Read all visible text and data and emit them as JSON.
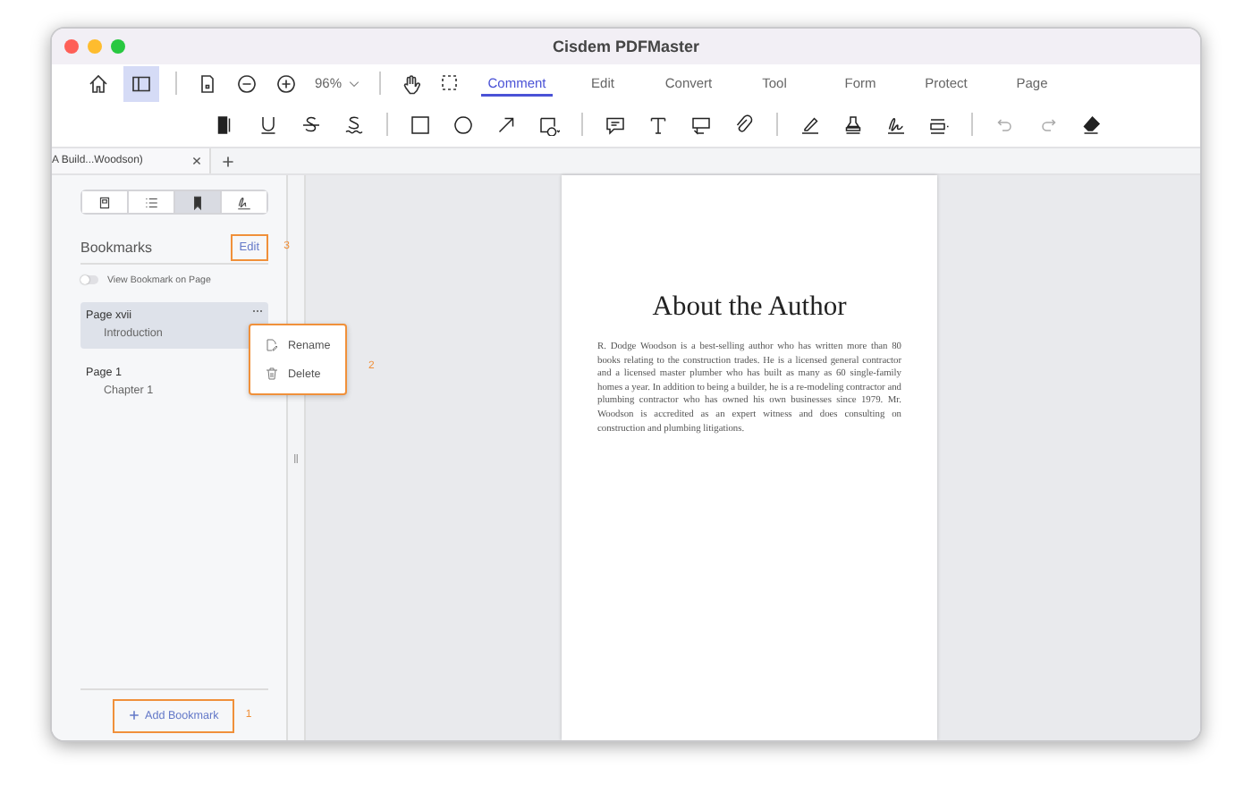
{
  "window": {
    "title": "Cisdem PDFMaster"
  },
  "toolbar": {
    "sidebar_toggle": {
      "selected": true
    },
    "zoom": "96%",
    "tabs": [
      {
        "label": "Comment",
        "selected": true
      },
      {
        "label": "Edit",
        "selected": false
      },
      {
        "label": "Convert",
        "selected": false
      },
      {
        "label": "Tool",
        "selected": false
      },
      {
        "label": "Form",
        "selected": false
      },
      {
        "label": "Protect",
        "selected": false
      },
      {
        "label": "Page",
        "selected": false
      }
    ]
  },
  "document_tabs": [
    {
      "label": "A Build...Woodson)"
    }
  ],
  "sidebar": {
    "panel_tabs": [
      {
        "selected": false
      },
      {
        "selected": false
      },
      {
        "selected": true
      },
      {
        "selected": false
      }
    ],
    "heading": "Bookmarks",
    "edit_button": {
      "label": "Edit",
      "highlighted": true,
      "callout": "3"
    },
    "toggle": {
      "label": "View Bookmark on Page",
      "on": false
    },
    "bookmarks": [
      {
        "page": "Page xvii",
        "title": "Introduction",
        "selected": true
      },
      {
        "page": "Page 1",
        "title": "Chapter 1",
        "selected": false
      }
    ],
    "context_menu": {
      "items": [
        {
          "kind": "rename",
          "label": "Rename"
        },
        {
          "kind": "delete",
          "label": "Delete"
        }
      ],
      "highlighted": true,
      "callout": "2"
    },
    "add_button": {
      "label": "Add Bookmark",
      "highlighted": true,
      "callout": "1"
    }
  },
  "document": {
    "title": "About the Author",
    "paragraph": "R. Dodge Woodson is a best-selling author who has written more than 80 books relating to the construction trades. He is a licensed general contractor and a licensed master plumber who has built as many as 60 single-family homes a year. In addition to being a builder, he is a re-modeling contractor and plumbing contractor who has owned his own businesses since 1979. Mr. Woodson is accredited as an expert witness and does consulting on construction and plumbing litigations."
  }
}
